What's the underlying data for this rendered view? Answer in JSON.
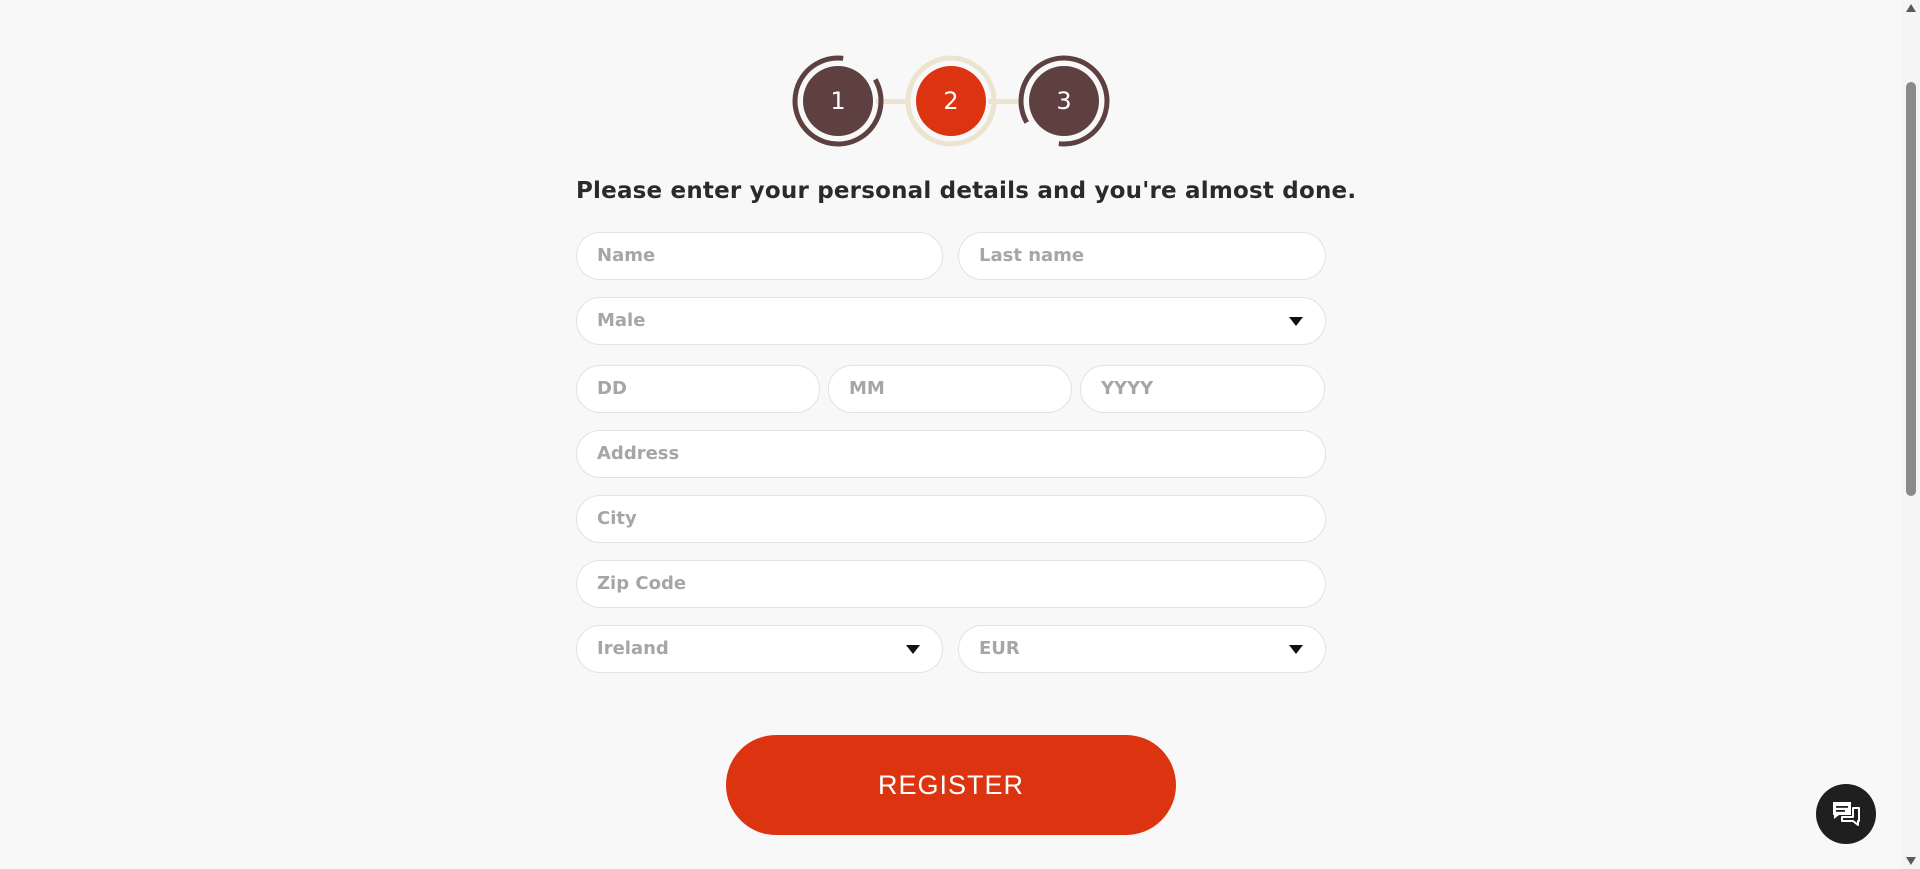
{
  "stepper": {
    "steps": [
      {
        "label": "1",
        "state": "complete"
      },
      {
        "label": "2",
        "state": "active"
      },
      {
        "label": "3",
        "state": "upcoming"
      }
    ],
    "colors": {
      "inactive": "#5e4040",
      "active": "#dc3410",
      "ring_active": "#ece3d0"
    }
  },
  "form": {
    "heading": "Please enter your personal details and you're almost done.",
    "name": {
      "placeholder": "Name"
    },
    "last_name": {
      "placeholder": "Last name"
    },
    "gender": {
      "selected": "Male"
    },
    "dob_day": {
      "placeholder": "DD"
    },
    "dob_month": {
      "placeholder": "MM"
    },
    "dob_year": {
      "placeholder": "YYYY"
    },
    "address": {
      "placeholder": "Address"
    },
    "city": {
      "placeholder": "City"
    },
    "zip": {
      "placeholder": "Zip Code"
    },
    "country": {
      "selected": "Ireland"
    },
    "currency": {
      "selected": "EUR"
    }
  },
  "register": {
    "label": "REGISTER",
    "color": "#dc3410"
  },
  "chat": {
    "icon": "chat-bubbles-icon"
  }
}
